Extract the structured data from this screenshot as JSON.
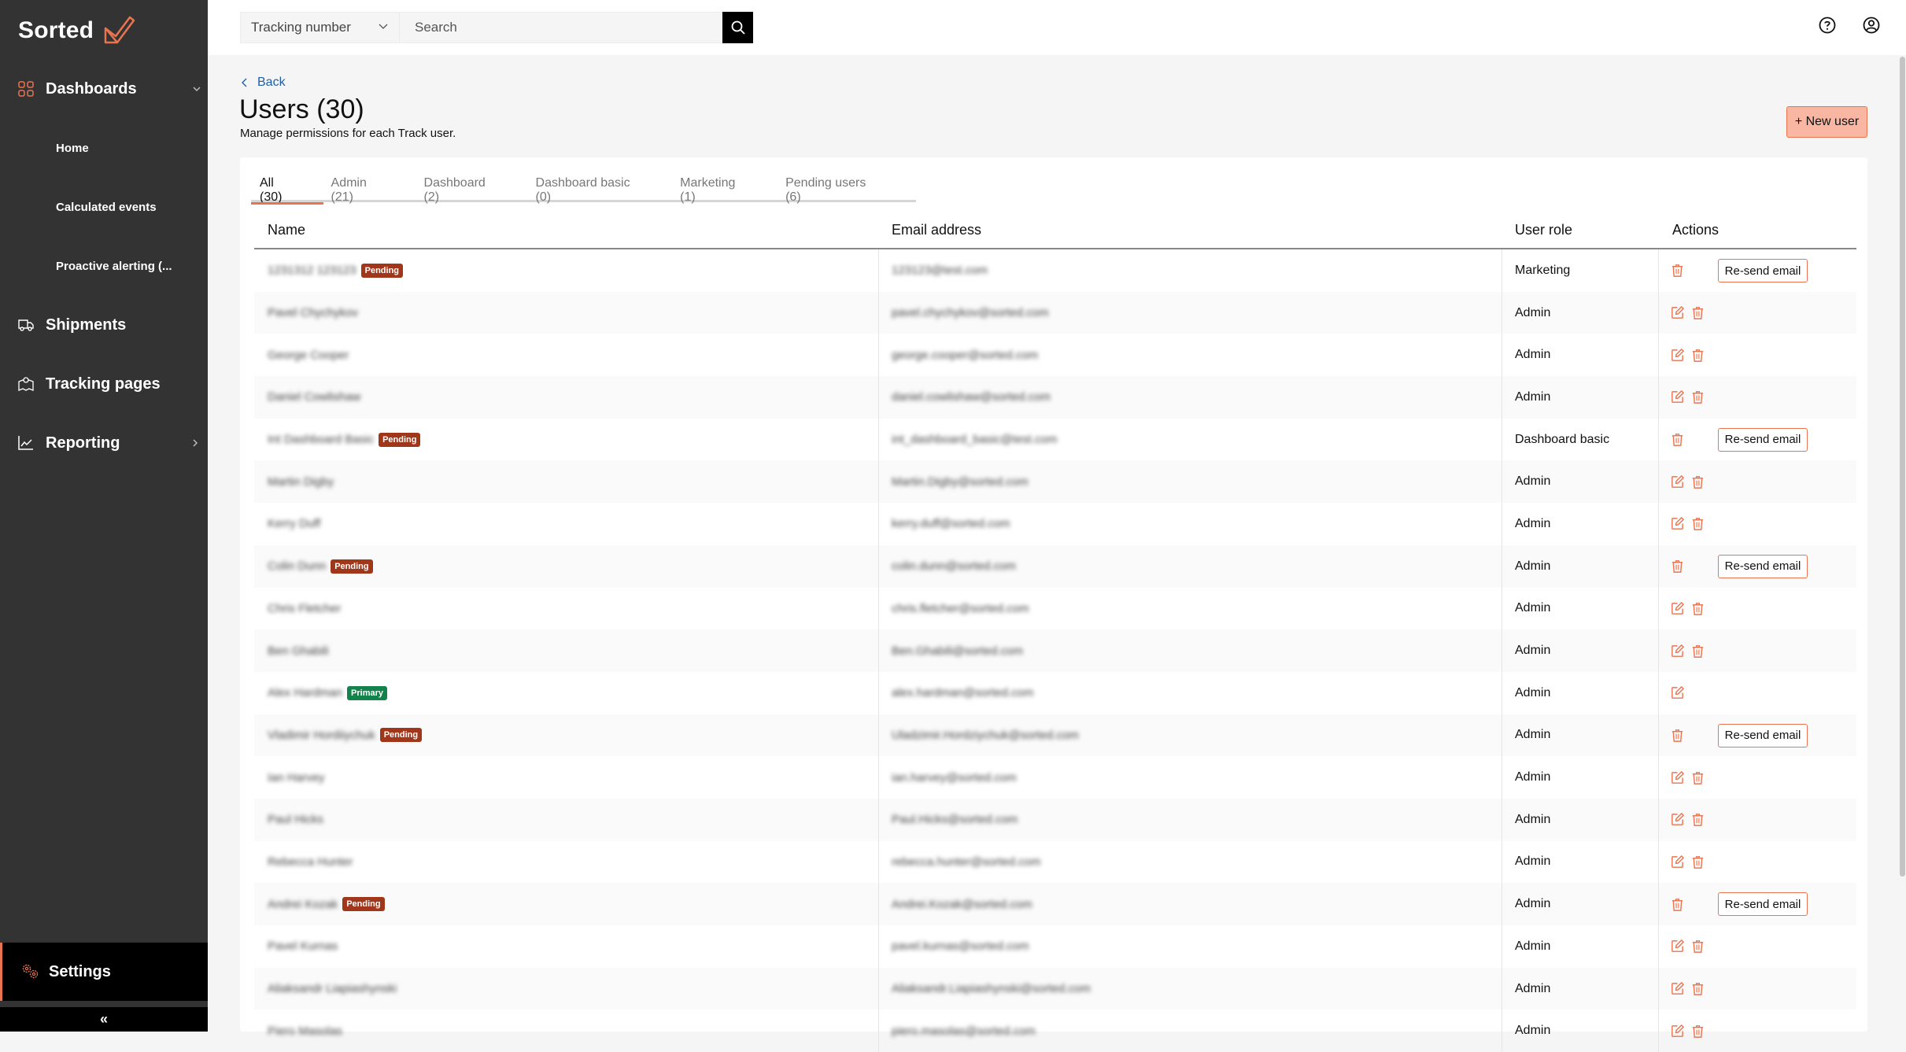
{
  "app": {
    "brand": "Sorted",
    "accent_color": "#e9744f",
    "sidebar_bg": "#333333"
  },
  "sidebar": {
    "items": [
      {
        "label": "Dashboards",
        "icon": "grid-icon",
        "chevron": "chevron-down-icon"
      },
      {
        "label": "Home"
      },
      {
        "label": "Calculated events"
      },
      {
        "label": "Proactive alerting (..."
      },
      {
        "label": "Shipments",
        "icon": "truck-icon"
      },
      {
        "label": "Tracking pages",
        "icon": "map-pin-icon"
      },
      {
        "label": "Reporting",
        "icon": "chart-line-icon",
        "chevron": "chevron-right-icon"
      }
    ],
    "settings_label": "Settings",
    "collapse_label": "«"
  },
  "topbar": {
    "search_type": "Tracking number",
    "search_placeholder": "Search"
  },
  "page": {
    "back_label": "Back",
    "title": "Users (30)",
    "subtitle": "Manage permissions for each Track user.",
    "new_user_label": "+ New user"
  },
  "tabs": [
    {
      "label": "All (30)",
      "active": true
    },
    {
      "label": "Admin (21)"
    },
    {
      "label": "Dashboard (2)"
    },
    {
      "label": "Dashboard basic (0)"
    },
    {
      "label": "Marketing (1)"
    },
    {
      "label": "Pending users (6)"
    }
  ],
  "table": {
    "headers": {
      "name": "Name",
      "email": "Email address",
      "role": "User role",
      "actions": "Actions"
    },
    "resend_label": "Re-send email",
    "badge_labels": {
      "pending": "Pending",
      "primary": "Primary"
    },
    "rows": [
      {
        "name": "1231312 123123",
        "email": "123123@test.com",
        "role": "Marketing",
        "badge": "pending",
        "edit": false,
        "delete": true,
        "resend": true
      },
      {
        "name": "Pavel Chychykov",
        "email": "pavel.chychykov@sorted.com",
        "role": "Admin",
        "badge": null,
        "edit": true,
        "delete": true,
        "resend": false
      },
      {
        "name": "George Cooper",
        "email": "george.cooper@sorted.com",
        "role": "Admin",
        "badge": null,
        "edit": true,
        "delete": true,
        "resend": false
      },
      {
        "name": "Daniel Cowlishaw",
        "email": "daniel.cowlishaw@sorted.com",
        "role": "Admin",
        "badge": null,
        "edit": true,
        "delete": true,
        "resend": false
      },
      {
        "name": "Int Dashboard Basic",
        "email": "int_dashboard_basic@test.com",
        "role": "Dashboard basic",
        "badge": "pending",
        "edit": false,
        "delete": true,
        "resend": true
      },
      {
        "name": "Martin Digby",
        "email": "Martin.Digby@sorted.com",
        "role": "Admin",
        "badge": null,
        "edit": true,
        "delete": true,
        "resend": false
      },
      {
        "name": "Kerry Duff",
        "email": "kerry.duff@sorted.com",
        "role": "Admin",
        "badge": null,
        "edit": true,
        "delete": true,
        "resend": false
      },
      {
        "name": "Colin Dunn",
        "email": "colin.dunn@sorted.com",
        "role": "Admin",
        "badge": "pending",
        "edit": false,
        "delete": true,
        "resend": true
      },
      {
        "name": "Chris Fletcher",
        "email": "chris.fletcher@sorted.com",
        "role": "Admin",
        "badge": null,
        "edit": true,
        "delete": true,
        "resend": false
      },
      {
        "name": "Ben Ghabili",
        "email": "Ben.Ghabili@sorted.com",
        "role": "Admin",
        "badge": null,
        "edit": true,
        "delete": true,
        "resend": false
      },
      {
        "name": "Alex Hardman",
        "email": "alex.hardman@sorted.com",
        "role": "Admin",
        "badge": "primary",
        "edit": true,
        "delete": false,
        "resend": false
      },
      {
        "name": "Vladimir Hordiiychuk",
        "email": "Uladzimir.Hordziychuk@sorted.com",
        "role": "Admin",
        "badge": "pending",
        "edit": false,
        "delete": true,
        "resend": true
      },
      {
        "name": "Ian Harvey",
        "email": "ian.harvey@sorted.com",
        "role": "Admin",
        "badge": null,
        "edit": true,
        "delete": true,
        "resend": false
      },
      {
        "name": "Paul Hicks",
        "email": "Paul.Hicks@sorted.com",
        "role": "Admin",
        "badge": null,
        "edit": true,
        "delete": true,
        "resend": false
      },
      {
        "name": "Rebecca Hunter",
        "email": "rebecca.hunter@sorted.com",
        "role": "Admin",
        "badge": null,
        "edit": true,
        "delete": true,
        "resend": false
      },
      {
        "name": "Andrei Kozak",
        "email": "Andrei.Kozak@sorted.com",
        "role": "Admin",
        "badge": "pending",
        "edit": false,
        "delete": true,
        "resend": true
      },
      {
        "name": "Pavel Kurnas",
        "email": "pavel.kurnas@sorted.com",
        "role": "Admin",
        "badge": null,
        "edit": true,
        "delete": true,
        "resend": false
      },
      {
        "name": "Aliaksandr Liapiashynski",
        "email": "Aliaksandr.Liapiashynski@sorted.com",
        "role": "Admin",
        "badge": null,
        "edit": true,
        "delete": true,
        "resend": false
      },
      {
        "name": "Piero Masolas",
        "email": "piero.masolas@sorted.com",
        "role": "Admin",
        "badge": null,
        "edit": true,
        "delete": true,
        "resend": false
      }
    ]
  }
}
